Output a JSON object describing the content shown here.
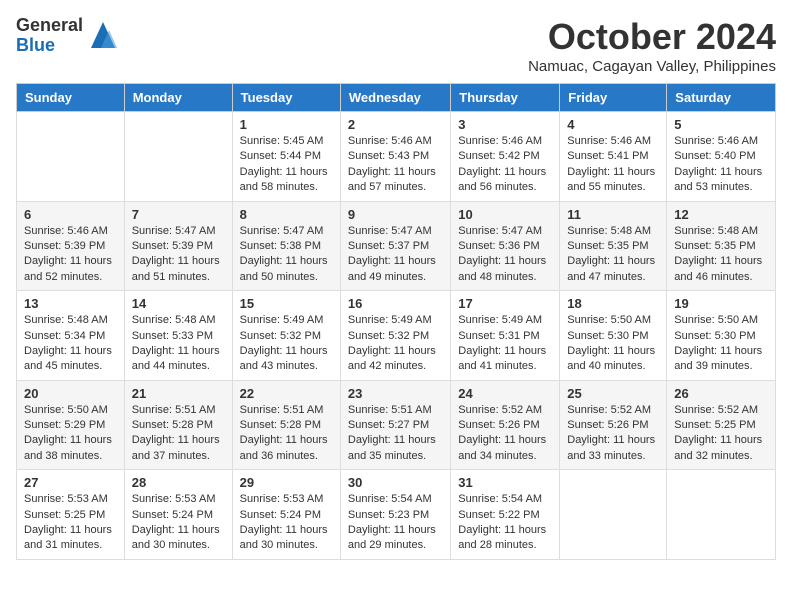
{
  "header": {
    "logo": {
      "general": "General",
      "blue": "Blue"
    },
    "title": "October 2024",
    "location": "Namuac, Cagayan Valley, Philippines"
  },
  "days_of_week": [
    "Sunday",
    "Monday",
    "Tuesday",
    "Wednesday",
    "Thursday",
    "Friday",
    "Saturday"
  ],
  "weeks": [
    [
      {
        "day": "",
        "sunrise": "",
        "sunset": "",
        "daylight": ""
      },
      {
        "day": "",
        "sunrise": "",
        "sunset": "",
        "daylight": ""
      },
      {
        "day": "1",
        "sunrise": "Sunrise: 5:45 AM",
        "sunset": "Sunset: 5:44 PM",
        "daylight": "Daylight: 11 hours and 58 minutes."
      },
      {
        "day": "2",
        "sunrise": "Sunrise: 5:46 AM",
        "sunset": "Sunset: 5:43 PM",
        "daylight": "Daylight: 11 hours and 57 minutes."
      },
      {
        "day": "3",
        "sunrise": "Sunrise: 5:46 AM",
        "sunset": "Sunset: 5:42 PM",
        "daylight": "Daylight: 11 hours and 56 minutes."
      },
      {
        "day": "4",
        "sunrise": "Sunrise: 5:46 AM",
        "sunset": "Sunset: 5:41 PM",
        "daylight": "Daylight: 11 hours and 55 minutes."
      },
      {
        "day": "5",
        "sunrise": "Sunrise: 5:46 AM",
        "sunset": "Sunset: 5:40 PM",
        "daylight": "Daylight: 11 hours and 53 minutes."
      }
    ],
    [
      {
        "day": "6",
        "sunrise": "Sunrise: 5:46 AM",
        "sunset": "Sunset: 5:39 PM",
        "daylight": "Daylight: 11 hours and 52 minutes."
      },
      {
        "day": "7",
        "sunrise": "Sunrise: 5:47 AM",
        "sunset": "Sunset: 5:39 PM",
        "daylight": "Daylight: 11 hours and 51 minutes."
      },
      {
        "day": "8",
        "sunrise": "Sunrise: 5:47 AM",
        "sunset": "Sunset: 5:38 PM",
        "daylight": "Daylight: 11 hours and 50 minutes."
      },
      {
        "day": "9",
        "sunrise": "Sunrise: 5:47 AM",
        "sunset": "Sunset: 5:37 PM",
        "daylight": "Daylight: 11 hours and 49 minutes."
      },
      {
        "day": "10",
        "sunrise": "Sunrise: 5:47 AM",
        "sunset": "Sunset: 5:36 PM",
        "daylight": "Daylight: 11 hours and 48 minutes."
      },
      {
        "day": "11",
        "sunrise": "Sunrise: 5:48 AM",
        "sunset": "Sunset: 5:35 PM",
        "daylight": "Daylight: 11 hours and 47 minutes."
      },
      {
        "day": "12",
        "sunrise": "Sunrise: 5:48 AM",
        "sunset": "Sunset: 5:35 PM",
        "daylight": "Daylight: 11 hours and 46 minutes."
      }
    ],
    [
      {
        "day": "13",
        "sunrise": "Sunrise: 5:48 AM",
        "sunset": "Sunset: 5:34 PM",
        "daylight": "Daylight: 11 hours and 45 minutes."
      },
      {
        "day": "14",
        "sunrise": "Sunrise: 5:48 AM",
        "sunset": "Sunset: 5:33 PM",
        "daylight": "Daylight: 11 hours and 44 minutes."
      },
      {
        "day": "15",
        "sunrise": "Sunrise: 5:49 AM",
        "sunset": "Sunset: 5:32 PM",
        "daylight": "Daylight: 11 hours and 43 minutes."
      },
      {
        "day": "16",
        "sunrise": "Sunrise: 5:49 AM",
        "sunset": "Sunset: 5:32 PM",
        "daylight": "Daylight: 11 hours and 42 minutes."
      },
      {
        "day": "17",
        "sunrise": "Sunrise: 5:49 AM",
        "sunset": "Sunset: 5:31 PM",
        "daylight": "Daylight: 11 hours and 41 minutes."
      },
      {
        "day": "18",
        "sunrise": "Sunrise: 5:50 AM",
        "sunset": "Sunset: 5:30 PM",
        "daylight": "Daylight: 11 hours and 40 minutes."
      },
      {
        "day": "19",
        "sunrise": "Sunrise: 5:50 AM",
        "sunset": "Sunset: 5:30 PM",
        "daylight": "Daylight: 11 hours and 39 minutes."
      }
    ],
    [
      {
        "day": "20",
        "sunrise": "Sunrise: 5:50 AM",
        "sunset": "Sunset: 5:29 PM",
        "daylight": "Daylight: 11 hours and 38 minutes."
      },
      {
        "day": "21",
        "sunrise": "Sunrise: 5:51 AM",
        "sunset": "Sunset: 5:28 PM",
        "daylight": "Daylight: 11 hours and 37 minutes."
      },
      {
        "day": "22",
        "sunrise": "Sunrise: 5:51 AM",
        "sunset": "Sunset: 5:28 PM",
        "daylight": "Daylight: 11 hours and 36 minutes."
      },
      {
        "day": "23",
        "sunrise": "Sunrise: 5:51 AM",
        "sunset": "Sunset: 5:27 PM",
        "daylight": "Daylight: 11 hours and 35 minutes."
      },
      {
        "day": "24",
        "sunrise": "Sunrise: 5:52 AM",
        "sunset": "Sunset: 5:26 PM",
        "daylight": "Daylight: 11 hours and 34 minutes."
      },
      {
        "day": "25",
        "sunrise": "Sunrise: 5:52 AM",
        "sunset": "Sunset: 5:26 PM",
        "daylight": "Daylight: 11 hours and 33 minutes."
      },
      {
        "day": "26",
        "sunrise": "Sunrise: 5:52 AM",
        "sunset": "Sunset: 5:25 PM",
        "daylight": "Daylight: 11 hours and 32 minutes."
      }
    ],
    [
      {
        "day": "27",
        "sunrise": "Sunrise: 5:53 AM",
        "sunset": "Sunset: 5:25 PM",
        "daylight": "Daylight: 11 hours and 31 minutes."
      },
      {
        "day": "28",
        "sunrise": "Sunrise: 5:53 AM",
        "sunset": "Sunset: 5:24 PM",
        "daylight": "Daylight: 11 hours and 30 minutes."
      },
      {
        "day": "29",
        "sunrise": "Sunrise: 5:53 AM",
        "sunset": "Sunset: 5:24 PM",
        "daylight": "Daylight: 11 hours and 30 minutes."
      },
      {
        "day": "30",
        "sunrise": "Sunrise: 5:54 AM",
        "sunset": "Sunset: 5:23 PM",
        "daylight": "Daylight: 11 hours and 29 minutes."
      },
      {
        "day": "31",
        "sunrise": "Sunrise: 5:54 AM",
        "sunset": "Sunset: 5:22 PM",
        "daylight": "Daylight: 11 hours and 28 minutes."
      },
      {
        "day": "",
        "sunrise": "",
        "sunset": "",
        "daylight": ""
      },
      {
        "day": "",
        "sunrise": "",
        "sunset": "",
        "daylight": ""
      }
    ]
  ]
}
